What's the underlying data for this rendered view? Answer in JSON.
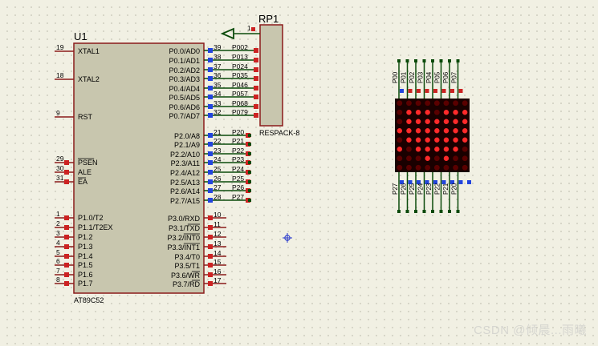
{
  "u1": {
    "ref": "U1",
    "part": "AT89C52",
    "left_pins": [
      {
        "num": "19",
        "name": "XTAL1"
      },
      {
        "num": "18",
        "name": "XTAL2"
      },
      {
        "num": "9",
        "name": "RST"
      },
      {
        "num": "29",
        "name": "PSEN",
        "overbar": true
      },
      {
        "num": "30",
        "name": "ALE"
      },
      {
        "num": "31",
        "name": "EA",
        "overbar": true
      },
      {
        "num": "1",
        "name": "P1.0/T2"
      },
      {
        "num": "2",
        "name": "P1.1/T2EX"
      },
      {
        "num": "3",
        "name": "P1.2"
      },
      {
        "num": "4",
        "name": "P1.3"
      },
      {
        "num": "5",
        "name": "P1.4"
      },
      {
        "num": "6",
        "name": "P1.5"
      },
      {
        "num": "7",
        "name": "P1.6"
      },
      {
        "num": "8",
        "name": "P1.7"
      }
    ],
    "p0_pins": [
      {
        "num": "39",
        "name": "P0.0/AD0",
        "net": "P002"
      },
      {
        "num": "38",
        "name": "P0.1/AD1",
        "net": "P013"
      },
      {
        "num": "37",
        "name": "P0.2/AD2",
        "net": "P024"
      },
      {
        "num": "36",
        "name": "P0.3/AD3",
        "net": "P035"
      },
      {
        "num": "35",
        "name": "P0.4/AD4",
        "net": "P046"
      },
      {
        "num": "34",
        "name": "P0.5/AD5",
        "net": "P057"
      },
      {
        "num": "33",
        "name": "P0.6/AD6",
        "net": "P068"
      },
      {
        "num": "32",
        "name": "P0.7/AD7",
        "net": "P079"
      }
    ],
    "p2_pins": [
      {
        "num": "21",
        "name": "P2.0/A8",
        "net": "P20"
      },
      {
        "num": "22",
        "name": "P2.1/A9",
        "net": "P21"
      },
      {
        "num": "23",
        "name": "P2.2/A10",
        "net": "P22"
      },
      {
        "num": "24",
        "name": "P2.3/A11",
        "net": "P23"
      },
      {
        "num": "25",
        "name": "P2.4/A12",
        "net": "P24"
      },
      {
        "num": "26",
        "name": "P2.5/A13",
        "net": "P25"
      },
      {
        "num": "27",
        "name": "P2.6/A14",
        "net": "P26"
      },
      {
        "num": "28",
        "name": "P2.7/A15",
        "net": "P27"
      }
    ],
    "p3_pins": [
      {
        "num": "10",
        "name": "P3.0/RXD"
      },
      {
        "num": "11",
        "name": "P3.1/TXD",
        "over": "TXD"
      },
      {
        "num": "12",
        "name": "P3.2/INT0",
        "over": "INT0"
      },
      {
        "num": "13",
        "name": "P3.3/INT1",
        "over": "INT1"
      },
      {
        "num": "14",
        "name": "P3.4/T0"
      },
      {
        "num": "15",
        "name": "P3.5/T1"
      },
      {
        "num": "16",
        "name": "P3.6/WR",
        "over": "WR"
      },
      {
        "num": "17",
        "name": "P3.7/RD",
        "over": "RD"
      }
    ]
  },
  "rp1": {
    "ref": "RP1",
    "part": "RESPACK-8",
    "pin1": "1"
  },
  "matrix": {
    "top_labels": [
      "P00",
      "P01",
      "P02",
      "P03",
      "P04",
      "P05",
      "P06",
      "P07"
    ],
    "bottom_labels": [
      "P27",
      "P26",
      "P25",
      "P24",
      "P23",
      "P22",
      "P21",
      "P20"
    ],
    "rows": 8,
    "cols": 8,
    "lit": [
      [
        0,
        0,
        0,
        0,
        0,
        0,
        0,
        0
      ],
      [
        0,
        1,
        1,
        1,
        0,
        1,
        1,
        1
      ],
      [
        0,
        1,
        1,
        1,
        1,
        1,
        1,
        1
      ],
      [
        1,
        1,
        1,
        1,
        1,
        1,
        1,
        1
      ],
      [
        0,
        1,
        1,
        1,
        1,
        1,
        1,
        1
      ],
      [
        1,
        0,
        1,
        1,
        1,
        1,
        1,
        0
      ],
      [
        0,
        0,
        0,
        1,
        0,
        1,
        0,
        0
      ],
      [
        0,
        0,
        0,
        0,
        0,
        0,
        0,
        0
      ]
    ]
  },
  "colors": {
    "component_border": "#8b1a1a",
    "component_fill": "#c8c6ae",
    "wire": "#0a4a0a",
    "pin_red": "#cc2222",
    "pin_blue": "#2244dd",
    "led_on": "#ff2a2a",
    "led_off": "#5a0000",
    "matrix_bg": "#1a0000"
  },
  "watermark": "CSDN @倾晨...雨曦"
}
